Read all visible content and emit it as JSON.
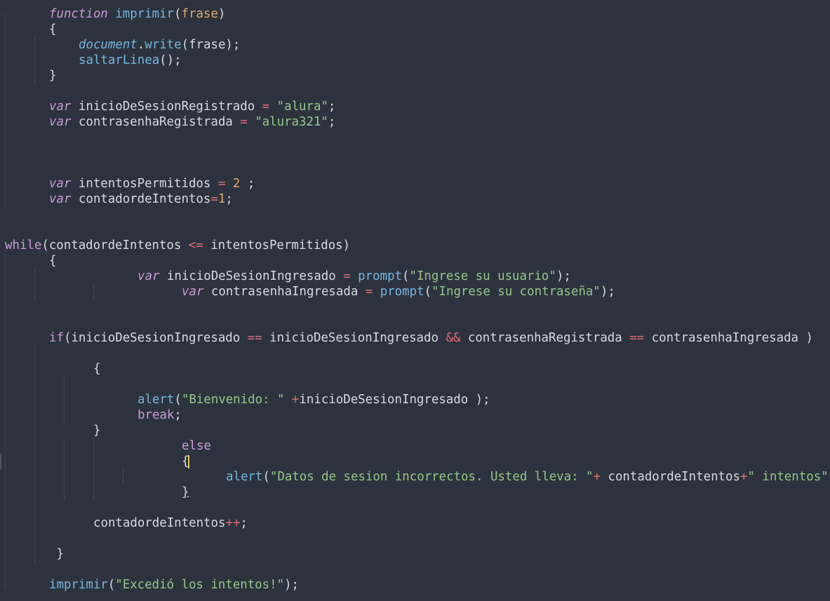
{
  "editor": {
    "lines": [
      {
        "indent": 6,
        "tokens": [
          {
            "t": "function",
            "c": "kwi"
          },
          {
            "t": " ",
            "c": "plain"
          },
          {
            "t": "imprimir",
            "c": "fn"
          },
          {
            "t": "(",
            "c": "plain"
          },
          {
            "t": "frase",
            "c": "param"
          },
          {
            "t": ")",
            "c": "plain"
          }
        ]
      },
      {
        "indent": 6,
        "tokens": [
          {
            "t": "{",
            "c": "plain"
          }
        ]
      },
      {
        "indent": 10,
        "tokens": [
          {
            "t": "document",
            "c": "obj"
          },
          {
            "t": ".",
            "c": "plain"
          },
          {
            "t": "write",
            "c": "fn"
          },
          {
            "t": "(frase);",
            "c": "plain"
          }
        ]
      },
      {
        "indent": 10,
        "tokens": [
          {
            "t": "saltarLinea",
            "c": "fn"
          },
          {
            "t": "();",
            "c": "plain"
          }
        ]
      },
      {
        "indent": 6,
        "tokens": [
          {
            "t": "}",
            "c": "plain"
          }
        ]
      },
      {
        "indent": 0,
        "tokens": []
      },
      {
        "indent": 6,
        "tokens": [
          {
            "t": "var",
            "c": "kwi"
          },
          {
            "t": " inicioDeSesionRegistrado ",
            "c": "plain"
          },
          {
            "t": "=",
            "c": "op"
          },
          {
            "t": " ",
            "c": "plain"
          },
          {
            "t": "\"alura\"",
            "c": "str"
          },
          {
            "t": ";",
            "c": "plain"
          }
        ]
      },
      {
        "indent": 6,
        "tokens": [
          {
            "t": "var",
            "c": "kwi"
          },
          {
            "t": " contrasenhaRegistrada ",
            "c": "plain"
          },
          {
            "t": "=",
            "c": "op"
          },
          {
            "t": " ",
            "c": "plain"
          },
          {
            "t": "\"alura321\"",
            "c": "str"
          },
          {
            "t": ";",
            "c": "plain"
          }
        ]
      },
      {
        "indent": 0,
        "tokens": []
      },
      {
        "indent": 0,
        "tokens": []
      },
      {
        "indent": 0,
        "tokens": []
      },
      {
        "indent": 6,
        "tokens": [
          {
            "t": "var",
            "c": "kwi"
          },
          {
            "t": " intentosPermitidos ",
            "c": "plain"
          },
          {
            "t": "=",
            "c": "op"
          },
          {
            "t": " ",
            "c": "plain"
          },
          {
            "t": "2",
            "c": "num"
          },
          {
            "t": " ;",
            "c": "plain"
          }
        ]
      },
      {
        "indent": 6,
        "tokens": [
          {
            "t": "var",
            "c": "kwi"
          },
          {
            "t": " contadordeIntentos",
            "c": "plain"
          },
          {
            "t": "=",
            "c": "op"
          },
          {
            "t": "1",
            "c": "num"
          },
          {
            "t": ";",
            "c": "plain"
          }
        ]
      },
      {
        "indent": 0,
        "tokens": []
      },
      {
        "indent": 0,
        "tokens": []
      },
      {
        "indent": 0,
        "tokens": [
          {
            "t": "while",
            "c": "kw"
          },
          {
            "t": "(contadordeIntentos ",
            "c": "plain"
          },
          {
            "t": "<=",
            "c": "op"
          },
          {
            "t": " intentosPermitidos)",
            "c": "plain"
          }
        ]
      },
      {
        "indent": 6,
        "tokens": [
          {
            "t": "{",
            "c": "plain"
          }
        ]
      },
      {
        "indent": 18,
        "tokens": [
          {
            "t": "var",
            "c": "kwi"
          },
          {
            "t": " inicioDeSesionIngresado ",
            "c": "plain"
          },
          {
            "t": "=",
            "c": "op"
          },
          {
            "t": " ",
            "c": "plain"
          },
          {
            "t": "prompt",
            "c": "fn"
          },
          {
            "t": "(",
            "c": "plain"
          },
          {
            "t": "\"Ingrese su usuario\"",
            "c": "str"
          },
          {
            "t": ");",
            "c": "plain"
          }
        ]
      },
      {
        "indent": 24,
        "tokens": [
          {
            "t": "var",
            "c": "kwi"
          },
          {
            "t": " contrasenhaIngresada ",
            "c": "plain"
          },
          {
            "t": "=",
            "c": "op"
          },
          {
            "t": " ",
            "c": "plain"
          },
          {
            "t": "prompt",
            "c": "fn"
          },
          {
            "t": "(",
            "c": "plain"
          },
          {
            "t": "\"Ingrese su contraseña\"",
            "c": "str"
          },
          {
            "t": ");",
            "c": "plain"
          }
        ]
      },
      {
        "indent": 0,
        "tokens": []
      },
      {
        "indent": 0,
        "tokens": []
      },
      {
        "indent": 6,
        "tokens": [
          {
            "t": "if",
            "c": "kw"
          },
          {
            "t": "(inicioDeSesionIngresado ",
            "c": "plain"
          },
          {
            "t": "==",
            "c": "op"
          },
          {
            "t": " inicioDeSesionIngresado ",
            "c": "plain"
          },
          {
            "t": "&&",
            "c": "op"
          },
          {
            "t": " contrasenhaRegistrada ",
            "c": "plain"
          },
          {
            "t": "==",
            "c": "op"
          },
          {
            "t": " contrasenhaIngresada )",
            "c": "plain"
          }
        ]
      },
      {
        "indent": 0,
        "tokens": []
      },
      {
        "indent": 12,
        "tokens": [
          {
            "t": "{",
            "c": "plain"
          }
        ]
      },
      {
        "indent": 0,
        "tokens": []
      },
      {
        "indent": 18,
        "tokens": [
          {
            "t": "alert",
            "c": "fn"
          },
          {
            "t": "(",
            "c": "plain"
          },
          {
            "t": "\"Bienvenido: \"",
            "c": "str"
          },
          {
            "t": " ",
            "c": "plain"
          },
          {
            "t": "+",
            "c": "op"
          },
          {
            "t": "inicioDeSesionIngresado );",
            "c": "plain"
          }
        ]
      },
      {
        "indent": 18,
        "tokens": [
          {
            "t": "break",
            "c": "kw"
          },
          {
            "t": ";",
            "c": "plain"
          }
        ]
      },
      {
        "indent": 12,
        "tokens": [
          {
            "t": "}",
            "c": "plain"
          }
        ]
      },
      {
        "indent": 24,
        "tokens": [
          {
            "t": "else",
            "c": "kw"
          }
        ]
      },
      {
        "indent": 24,
        "tokens": [
          {
            "t": "{",
            "c": "cursor"
          }
        ]
      },
      {
        "indent": 30,
        "tokens": [
          {
            "t": "alert",
            "c": "fn"
          },
          {
            "t": "(",
            "c": "plain"
          },
          {
            "t": "\"Datos de sesion incorrectos. Usted lleva: \"",
            "c": "str"
          },
          {
            "t": "+",
            "c": "op"
          },
          {
            "t": " contadordeIntentos",
            "c": "plain"
          },
          {
            "t": "+",
            "c": "op"
          },
          {
            "t": "\" intentos\"",
            "c": "str"
          },
          {
            "t": ");",
            "c": "plain"
          }
        ]
      },
      {
        "indent": 24,
        "tokens": [
          {
            "t": "}",
            "c": "underline"
          }
        ]
      },
      {
        "indent": 0,
        "tokens": []
      },
      {
        "indent": 12,
        "tokens": [
          {
            "t": "contadordeIntentos",
            "c": "plain"
          },
          {
            "t": "++",
            "c": "op"
          },
          {
            "t": ";",
            "c": "plain"
          }
        ]
      },
      {
        "indent": 0,
        "tokens": []
      },
      {
        "indent": 7,
        "tokens": [
          {
            "t": "}",
            "c": "plain"
          }
        ]
      },
      {
        "indent": 0,
        "tokens": []
      },
      {
        "indent": 6,
        "tokens": [
          {
            "t": "imprimir",
            "c": "fn"
          },
          {
            "t": "(",
            "c": "plain"
          },
          {
            "t": "\"Excedió los intentos!\"",
            "c": "str"
          },
          {
            "t": ");",
            "c": "plain"
          }
        ]
      }
    ]
  },
  "colors": {
    "background": "#2d333e",
    "keyword": "#c89bd8",
    "function": "#75b6e0",
    "string": "#98c58a",
    "number": "#e5a46a",
    "operator": "#e06c75",
    "text": "#d7dae0",
    "cursor": "#e8c75f"
  }
}
